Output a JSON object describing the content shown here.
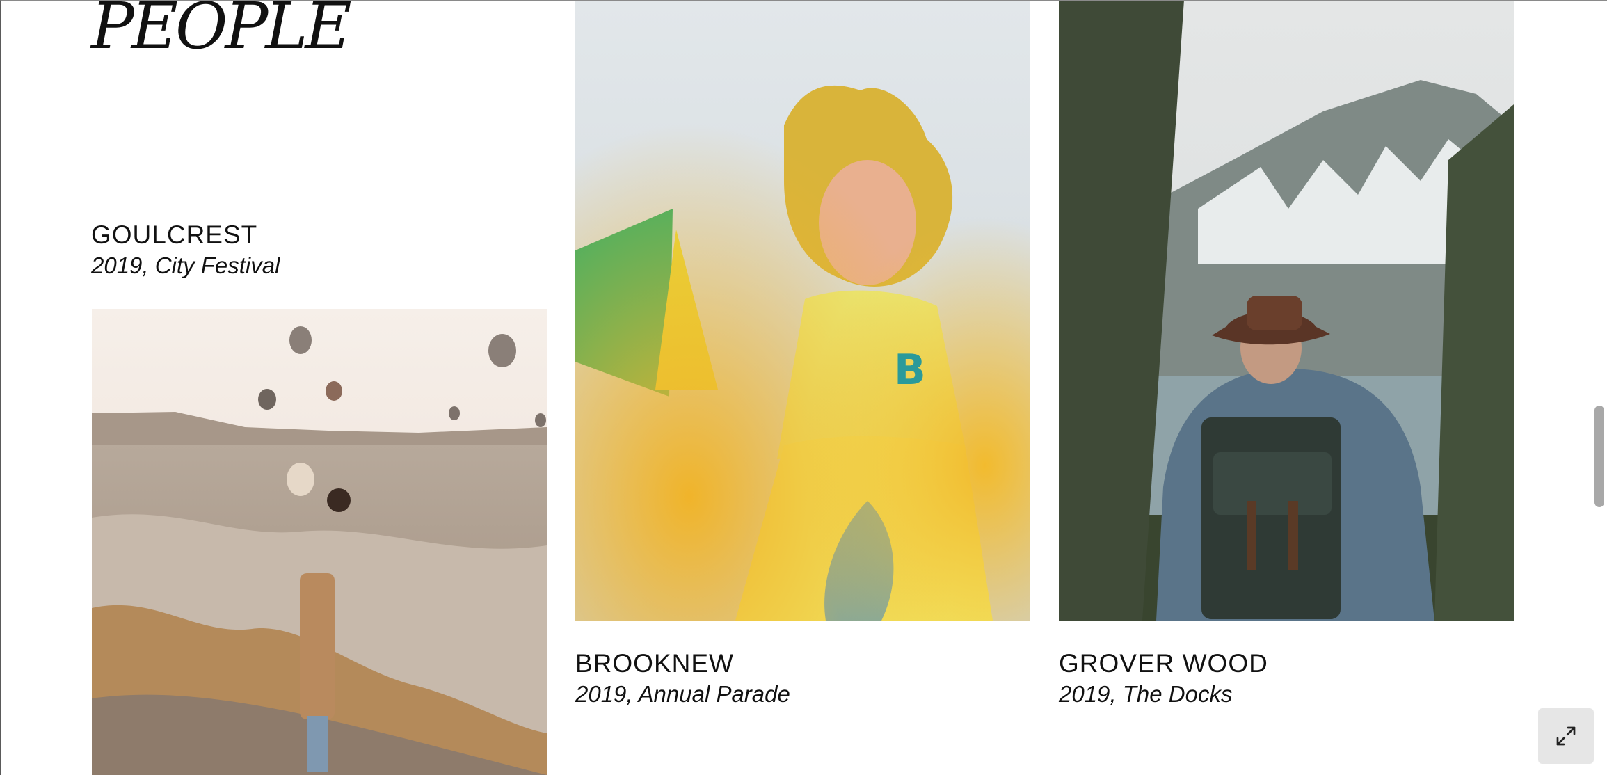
{
  "section": {
    "title": "PEOPLE"
  },
  "items": [
    {
      "name": "GOULCREST",
      "subtitle": "2019, City Festival"
    },
    {
      "name": "BROOKNEW",
      "subtitle": "2019, Annual Parade"
    },
    {
      "name": "GROVER WOOD",
      "subtitle": "2019, The Docks"
    }
  ],
  "controls": {
    "expand_icon": "expand-arrows-icon"
  },
  "colors": {
    "background": "#ffffff",
    "text": "#111111",
    "button_bg": "#e6e6e6",
    "scroll_thumb": "#a8a8a8"
  }
}
